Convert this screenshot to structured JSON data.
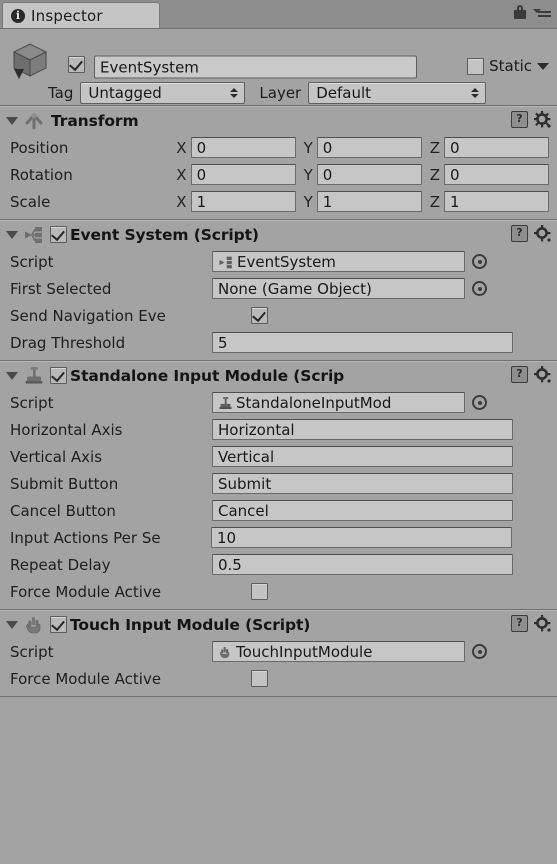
{
  "window": {
    "tab_label": "Inspector",
    "tab_icon": "info-icon",
    "lock_icon": "lock-icon",
    "menu_icon": "menu-icon"
  },
  "gameobject": {
    "icon": "cube-icon",
    "enabled": true,
    "name": "EventSystem",
    "static_label": "Static",
    "static_checked": false,
    "tag_label": "Tag",
    "tag_value": "Untagged",
    "layer_label": "Layer",
    "layer_value": "Default"
  },
  "components": [
    {
      "title": "Transform",
      "icon": "transform-axis-icon",
      "has_enable_checkbox": false,
      "expanded": true,
      "help_icon": "help-book-icon",
      "gear_icon": "gear-icon",
      "vectors": [
        {
          "label": "Position",
          "x": "0",
          "y": "0",
          "z": "0"
        },
        {
          "label": "Rotation",
          "x": "0",
          "y": "0",
          "z": "0"
        },
        {
          "label": "Scale",
          "x": "1",
          "y": "1",
          "z": "1"
        }
      ],
      "axis_labels": [
        "X",
        "Y",
        "Z"
      ]
    },
    {
      "title": "Event System (Script)",
      "icon": "event-system-icon",
      "has_enable_checkbox": true,
      "enabled": true,
      "expanded": true,
      "help_icon": "help-book-icon",
      "gear_icon": "gear-icon",
      "fields": [
        {
          "label": "Script",
          "type": "object",
          "value": "EventSystem",
          "value_icon": "event-system-icon",
          "picker": true
        },
        {
          "label": "First Selected",
          "type": "object",
          "value": "None (Game Object)",
          "picker": true
        },
        {
          "label": "Send Navigation Eve",
          "type": "checkbox",
          "checked": true
        },
        {
          "label": "Drag Threshold",
          "type": "text",
          "value": "5"
        }
      ]
    },
    {
      "title": "Standalone Input Module (Scrip",
      "icon": "joystick-icon",
      "has_enable_checkbox": true,
      "enabled": true,
      "expanded": true,
      "help_icon": "help-book-icon",
      "gear_icon": "gear-icon",
      "fields": [
        {
          "label": "Script",
          "type": "object",
          "value": "StandaloneInputMod",
          "value_icon": "joystick-icon",
          "picker": true
        },
        {
          "label": "Horizontal Axis",
          "type": "text",
          "value": "Horizontal"
        },
        {
          "label": "Vertical Axis",
          "type": "text",
          "value": "Vertical"
        },
        {
          "label": "Submit Button",
          "type": "text",
          "value": "Submit"
        },
        {
          "label": "Cancel Button",
          "type": "text",
          "value": "Cancel"
        },
        {
          "label": "Input Actions Per Se",
          "type": "text",
          "value": "10"
        },
        {
          "label": "Repeat Delay",
          "type": "text",
          "value": "0.5"
        },
        {
          "label": "Force Module Active",
          "type": "checkbox",
          "checked": false
        }
      ]
    },
    {
      "title": "Touch Input Module (Script)",
      "icon": "hand-icon",
      "has_enable_checkbox": true,
      "enabled": true,
      "expanded": true,
      "help_icon": "help-book-icon",
      "gear_icon": "gear-icon",
      "fields": [
        {
          "label": "Script",
          "type": "object",
          "value": "TouchInputModule",
          "value_icon": "hand-icon",
          "picker": true
        },
        {
          "label": "Force Module Active",
          "type": "checkbox",
          "checked": false
        }
      ]
    }
  ],
  "colors": {
    "panel_bg": "#a3a3a3",
    "tabbar_bg": "#8d8d8d",
    "tab_active": "#c5c5c5",
    "field_bg": "#c6c6c6",
    "text": "#1c1c1c"
  }
}
